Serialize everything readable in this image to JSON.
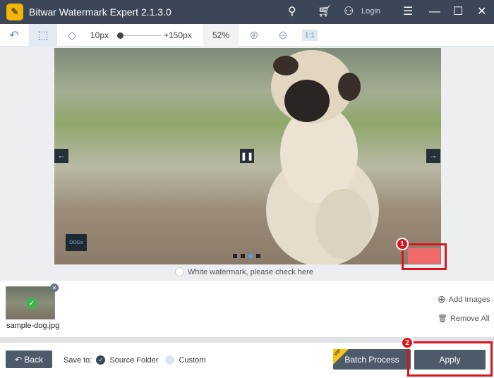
{
  "titlebar": {
    "title": "Bitwar Watermark Expert  2.1.3.0",
    "login": "Login",
    "icons": [
      "key-icon",
      "cart-icon",
      "user-icon",
      "menu-icon",
      "minimize-icon",
      "maximize-icon",
      "close-icon"
    ]
  },
  "toolbar": {
    "brush_min": "10px",
    "brush_max": "+150px",
    "zoom": "52%",
    "actual_size": "1:1",
    "brush_level_percent": 0
  },
  "canvas": {
    "thumb_label": "DOGs",
    "checkbox_label": "White watermark, please check here",
    "step1": "1",
    "slide_index": 3,
    "slide_count": 4
  },
  "strip": {
    "file": "sample-dog.jpg",
    "add_images": "Add Images",
    "remove_all": "Remove All"
  },
  "bottom": {
    "back": "Back",
    "save_to": "Save to:",
    "source_folder": "Source Folder",
    "custom": "Custom",
    "selected": "Source Folder",
    "batch": "Batch Process",
    "vip": "VIP",
    "apply": "Apply",
    "step2": "2"
  },
  "colors": {
    "titlebar": "#3b4656",
    "button": "#4d5a69",
    "highlight": "#d9141b",
    "accent": "#5b88c4"
  }
}
